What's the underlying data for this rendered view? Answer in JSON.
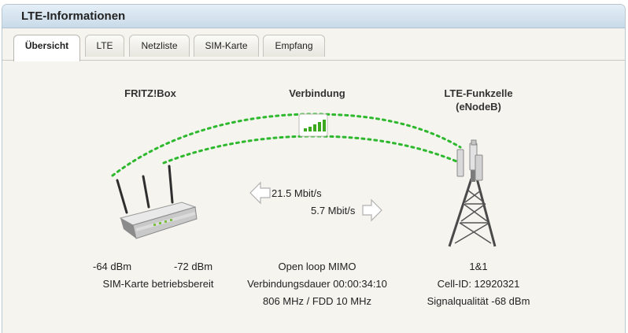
{
  "panel": {
    "title": "LTE-Informationen"
  },
  "tabs": [
    {
      "label": "Übersicht",
      "active": true
    },
    {
      "label": "LTE",
      "active": false
    },
    {
      "label": "Netzliste",
      "active": false
    },
    {
      "label": "SIM-Karte",
      "active": false
    },
    {
      "label": "Empfang",
      "active": false
    }
  ],
  "device": {
    "heading": "FRITZ!Box",
    "signal_1": "-64 dBm",
    "signal_2": "-72 dBm",
    "sim_status": "SIM-Karte betriebsbereit"
  },
  "connection": {
    "heading": "Verbindung",
    "downstream": "21.5 Mbit/s",
    "upstream": "5.7 Mbit/s",
    "signal_bars": 5,
    "mode": "Open loop MIMO",
    "duration": "Verbindungsdauer 00:00:34:10",
    "band": "806 MHz / FDD 10 MHz"
  },
  "cell": {
    "heading_line1": "LTE-Funkzelle",
    "heading_line2": "(eNodeB)",
    "provider": "1&1",
    "cell_id": "Cell-ID: 12920321",
    "quality": "Signalqualität -68 dBm"
  },
  "colors": {
    "link_dots": "#2db82d",
    "signal_green": "#3ca81e",
    "tab_active_bg": "#ffffff",
    "header_bg": "#c9dbe9"
  }
}
